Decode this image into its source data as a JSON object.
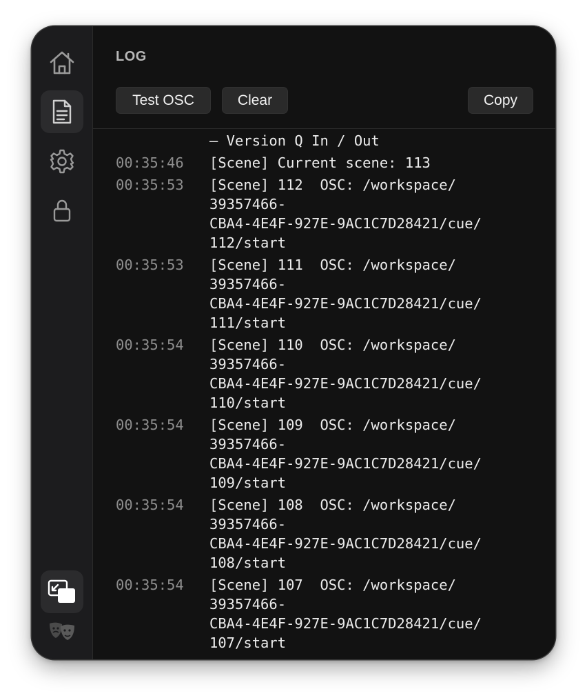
{
  "sidebar": {
    "items": [
      {
        "icon": "home-icon"
      },
      {
        "icon": "document-icon",
        "active": true
      },
      {
        "icon": "gear-icon"
      },
      {
        "icon": "lock-icon"
      }
    ],
    "bottom": [
      {
        "icon": "window-overlay-icon",
        "active": true
      },
      {
        "icon": "theater-masks-icon"
      }
    ]
  },
  "header": {
    "title": "LOG",
    "test_osc_label": "Test OSC",
    "clear_label": "Clear",
    "copy_label": "Copy"
  },
  "log": {
    "partial_first_line": "— Version Q In / Out",
    "entries": [
      {
        "time": "00:35:46",
        "lines": [
          "[Scene] Current scene: 113"
        ]
      },
      {
        "time": "00:35:53",
        "lines": [
          "[Scene] 112  OSC: /workspace/",
          "39357466-",
          "CBA4-4E4F-927E-9AC1C7D28421/cue/",
          "112/start"
        ]
      },
      {
        "time": "00:35:53",
        "lines": [
          "[Scene] 111  OSC: /workspace/",
          "39357466-",
          "CBA4-4E4F-927E-9AC1C7D28421/cue/",
          "111/start"
        ]
      },
      {
        "time": "00:35:54",
        "lines": [
          "[Scene] 110  OSC: /workspace/",
          "39357466-",
          "CBA4-4E4F-927E-9AC1C7D28421/cue/",
          "110/start"
        ]
      },
      {
        "time": "00:35:54",
        "lines": [
          "[Scene] 109  OSC: /workspace/",
          "39357466-",
          "CBA4-4E4F-927E-9AC1C7D28421/cue/",
          "109/start"
        ]
      },
      {
        "time": "00:35:54",
        "lines": [
          "[Scene] 108  OSC: /workspace/",
          "39357466-",
          "CBA4-4E4F-927E-9AC1C7D28421/cue/",
          "108/start"
        ]
      },
      {
        "time": "00:35:54",
        "lines": [
          "[Scene] 107  OSC: /workspace/",
          "39357466-",
          "CBA4-4E4F-927E-9AC1C7D28421/cue/",
          "107/start"
        ]
      }
    ]
  },
  "colors": {
    "background": "#141414",
    "sidebar": "#1c1c1e",
    "timestamp": "#8e8e8e",
    "message": "#ececec",
    "button": "#2a2a2a"
  }
}
